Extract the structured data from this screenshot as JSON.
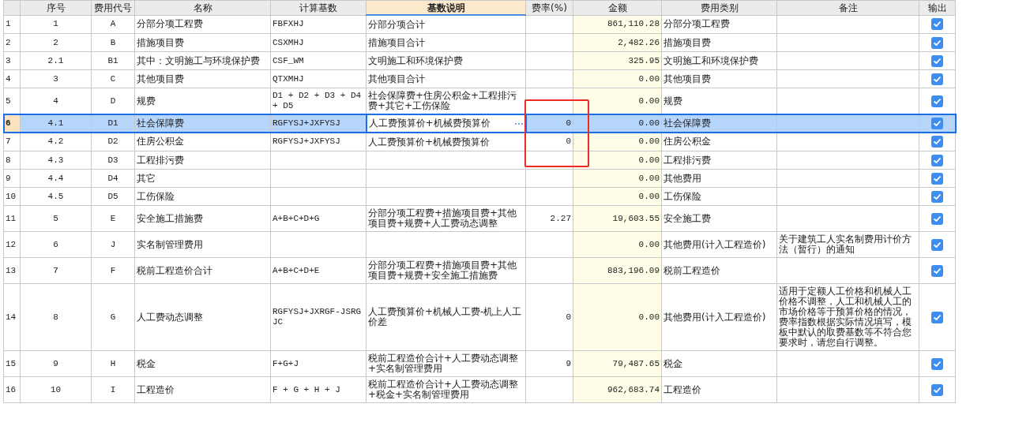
{
  "table": {
    "columns": [
      {
        "label": "序号",
        "selected": false
      },
      {
        "label": "费用代号",
        "selected": false
      },
      {
        "label": "名称",
        "selected": false
      },
      {
        "label": "计算基数",
        "selected": false
      },
      {
        "label": "基数说明",
        "selected": true
      },
      {
        "label": "费率(%)",
        "selected": false
      },
      {
        "label": "金额",
        "selected": false
      },
      {
        "label": "费用类别",
        "selected": false
      },
      {
        "label": "备注",
        "selected": false
      },
      {
        "label": "输出",
        "selected": false
      }
    ],
    "rows": [
      {
        "index": "1",
        "seq": "1",
        "code": "A",
        "name": "分部分项工程费",
        "base": "FBFXHJ",
        "base_desc": "分部分项合计",
        "rate": "",
        "amount": "861,110.28",
        "category": "分部分项工程费",
        "note": "",
        "output": true,
        "selected": false
      },
      {
        "index": "2",
        "seq": "2",
        "code": "B",
        "name": "措施项目费",
        "base": "CSXMHJ",
        "base_desc": "措施项目合计",
        "rate": "",
        "amount": "2,482.26",
        "category": "措施项目费",
        "note": "",
        "output": true,
        "selected": false
      },
      {
        "index": "3",
        "seq": "2.1",
        "code": "B1",
        "name": "其中：文明施工与环境保护费",
        "base": "CSF_WM",
        "base_desc": "文明施工和环境保护费",
        "rate": "",
        "amount": "325.95",
        "category": "文明施工和环境保护费",
        "note": "",
        "output": true,
        "selected": false
      },
      {
        "index": "4",
        "seq": "3",
        "code": "C",
        "name": "其他项目费",
        "base": "QTXMHJ",
        "base_desc": "其他项目合计",
        "rate": "",
        "amount": "0.00",
        "category": "其他项目费",
        "note": "",
        "output": true,
        "selected": false
      },
      {
        "index": "5",
        "seq": "4",
        "code": "D",
        "name": "规费",
        "base": "D1 + D2 + D3 + D4 + D5",
        "base_desc": "社会保障费+住房公积金+工程排污费+其它+工伤保险",
        "rate": "",
        "amount": "0.00",
        "category": "规费",
        "note": "",
        "output": true,
        "selected": false
      },
      {
        "index": "6",
        "seq": "4.1",
        "code": "D1",
        "name": "社会保障费",
        "base": "RGFYSJ+JXFYSJ",
        "base_desc": "人工费预算价+机械费预算价",
        "rate": "0",
        "amount": "0.00",
        "category": "社会保障费",
        "note": "",
        "output": true,
        "selected": true
      },
      {
        "index": "7",
        "seq": "4.2",
        "code": "D2",
        "name": "住房公积金",
        "base": "RGFYSJ+JXFYSJ",
        "base_desc": "人工费预算价+机械费预算价",
        "rate": "0",
        "amount": "0.00",
        "category": "住房公积金",
        "note": "",
        "output": true,
        "selected": false
      },
      {
        "index": "8",
        "seq": "4.3",
        "code": "D3",
        "name": "工程排污费",
        "base": "",
        "base_desc": "",
        "rate": "",
        "amount": "0.00",
        "category": "工程排污费",
        "note": "",
        "output": true,
        "selected": false
      },
      {
        "index": "9",
        "seq": "4.4",
        "code": "D4",
        "name": "其它",
        "base": "",
        "base_desc": "",
        "rate": "",
        "amount": "0.00",
        "category": "其他费用",
        "note": "",
        "output": true,
        "selected": false
      },
      {
        "index": "10",
        "seq": "4.5",
        "code": "D5",
        "name": "工伤保险",
        "base": "",
        "base_desc": "",
        "rate": "",
        "amount": "0.00",
        "category": "工伤保险",
        "note": "",
        "output": true,
        "selected": false
      },
      {
        "index": "11",
        "seq": "5",
        "code": "E",
        "name": "安全施工措施费",
        "base": "A+B+C+D+G",
        "base_desc": "分部分项工程费+措施项目费+其他项目费+规费+人工费动态调整",
        "rate": "2.27",
        "amount": "19,603.55",
        "category": "安全施工费",
        "note": "",
        "output": true,
        "selected": false
      },
      {
        "index": "12",
        "seq": "6",
        "code": "J",
        "name": "实名制管理费用",
        "base": "",
        "base_desc": "",
        "rate": "",
        "amount": "0.00",
        "category": "其他费用(计入工程造价)",
        "note": "关于建筑工人实名制费用计价方法（暂行）的通知",
        "output": true,
        "selected": false
      },
      {
        "index": "13",
        "seq": "7",
        "code": "F",
        "name": "税前工程造价合计",
        "base": "A+B+C+D+E",
        "base_desc": "分部分项工程费+措施项目费+其他项目费+规费+安全施工措施费",
        "rate": "",
        "amount": "883,196.09",
        "category": "税前工程造价",
        "note": "",
        "output": true,
        "selected": false
      },
      {
        "index": "14",
        "seq": "8",
        "code": "G",
        "name": "人工费动态调整",
        "base": "RGFYSJ+JXRGF-JSRGJC",
        "base_desc": "人工费预算价+机械人工费-机上人工价差",
        "rate": "0",
        "amount": "0.00",
        "category": "其他费用(计入工程造价)",
        "note": "适用于定额人工价格和机械人工价格不调整，人工和机械人工的市场价格等于预算价格的情况，费率指数根据实际情况填写，模板中默认的取费基数等不符合您要求时，请您自行调整。",
        "output": true,
        "selected": false
      },
      {
        "index": "15",
        "seq": "9",
        "code": "H",
        "name": "税金",
        "base": "F+G+J",
        "base_desc": "税前工程造价合计+人工费动态调整+实名制管理费用",
        "rate": "9",
        "amount": "79,487.65",
        "category": "税金",
        "note": "",
        "output": true,
        "selected": false
      },
      {
        "index": "16",
        "seq": "10",
        "code": "I",
        "name": "工程造价",
        "base": "F + G + H + J",
        "base_desc": "税前工程造价合计+人工费动态调整+税金+实名制管理费用",
        "rate": "",
        "amount": "962,683.74",
        "category": "工程造价",
        "note": "",
        "output": true,
        "selected": false
      }
    ]
  }
}
